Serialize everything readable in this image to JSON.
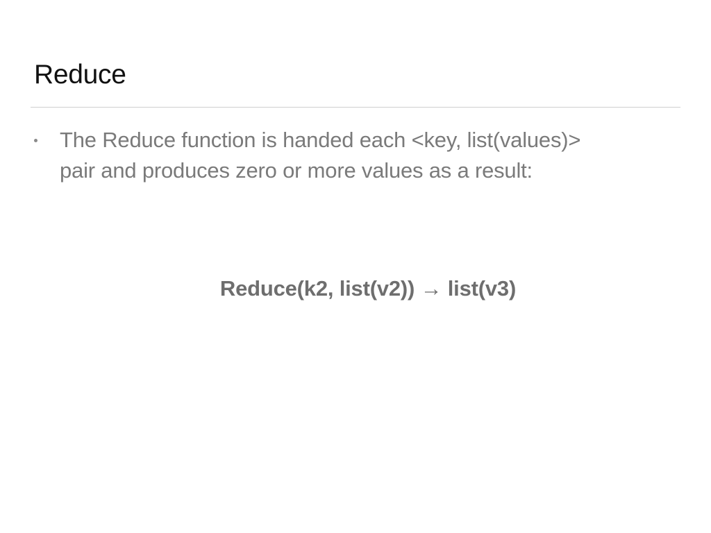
{
  "slide": {
    "title": "Reduce",
    "bullets": [
      {
        "lines": [
          "The Reduce function is handed each <key, list(values)>",
          "pair and produces zero or more values as a result:"
        ]
      }
    ],
    "formula": "Reduce(k2, list(v2)) → list(v3)"
  }
}
